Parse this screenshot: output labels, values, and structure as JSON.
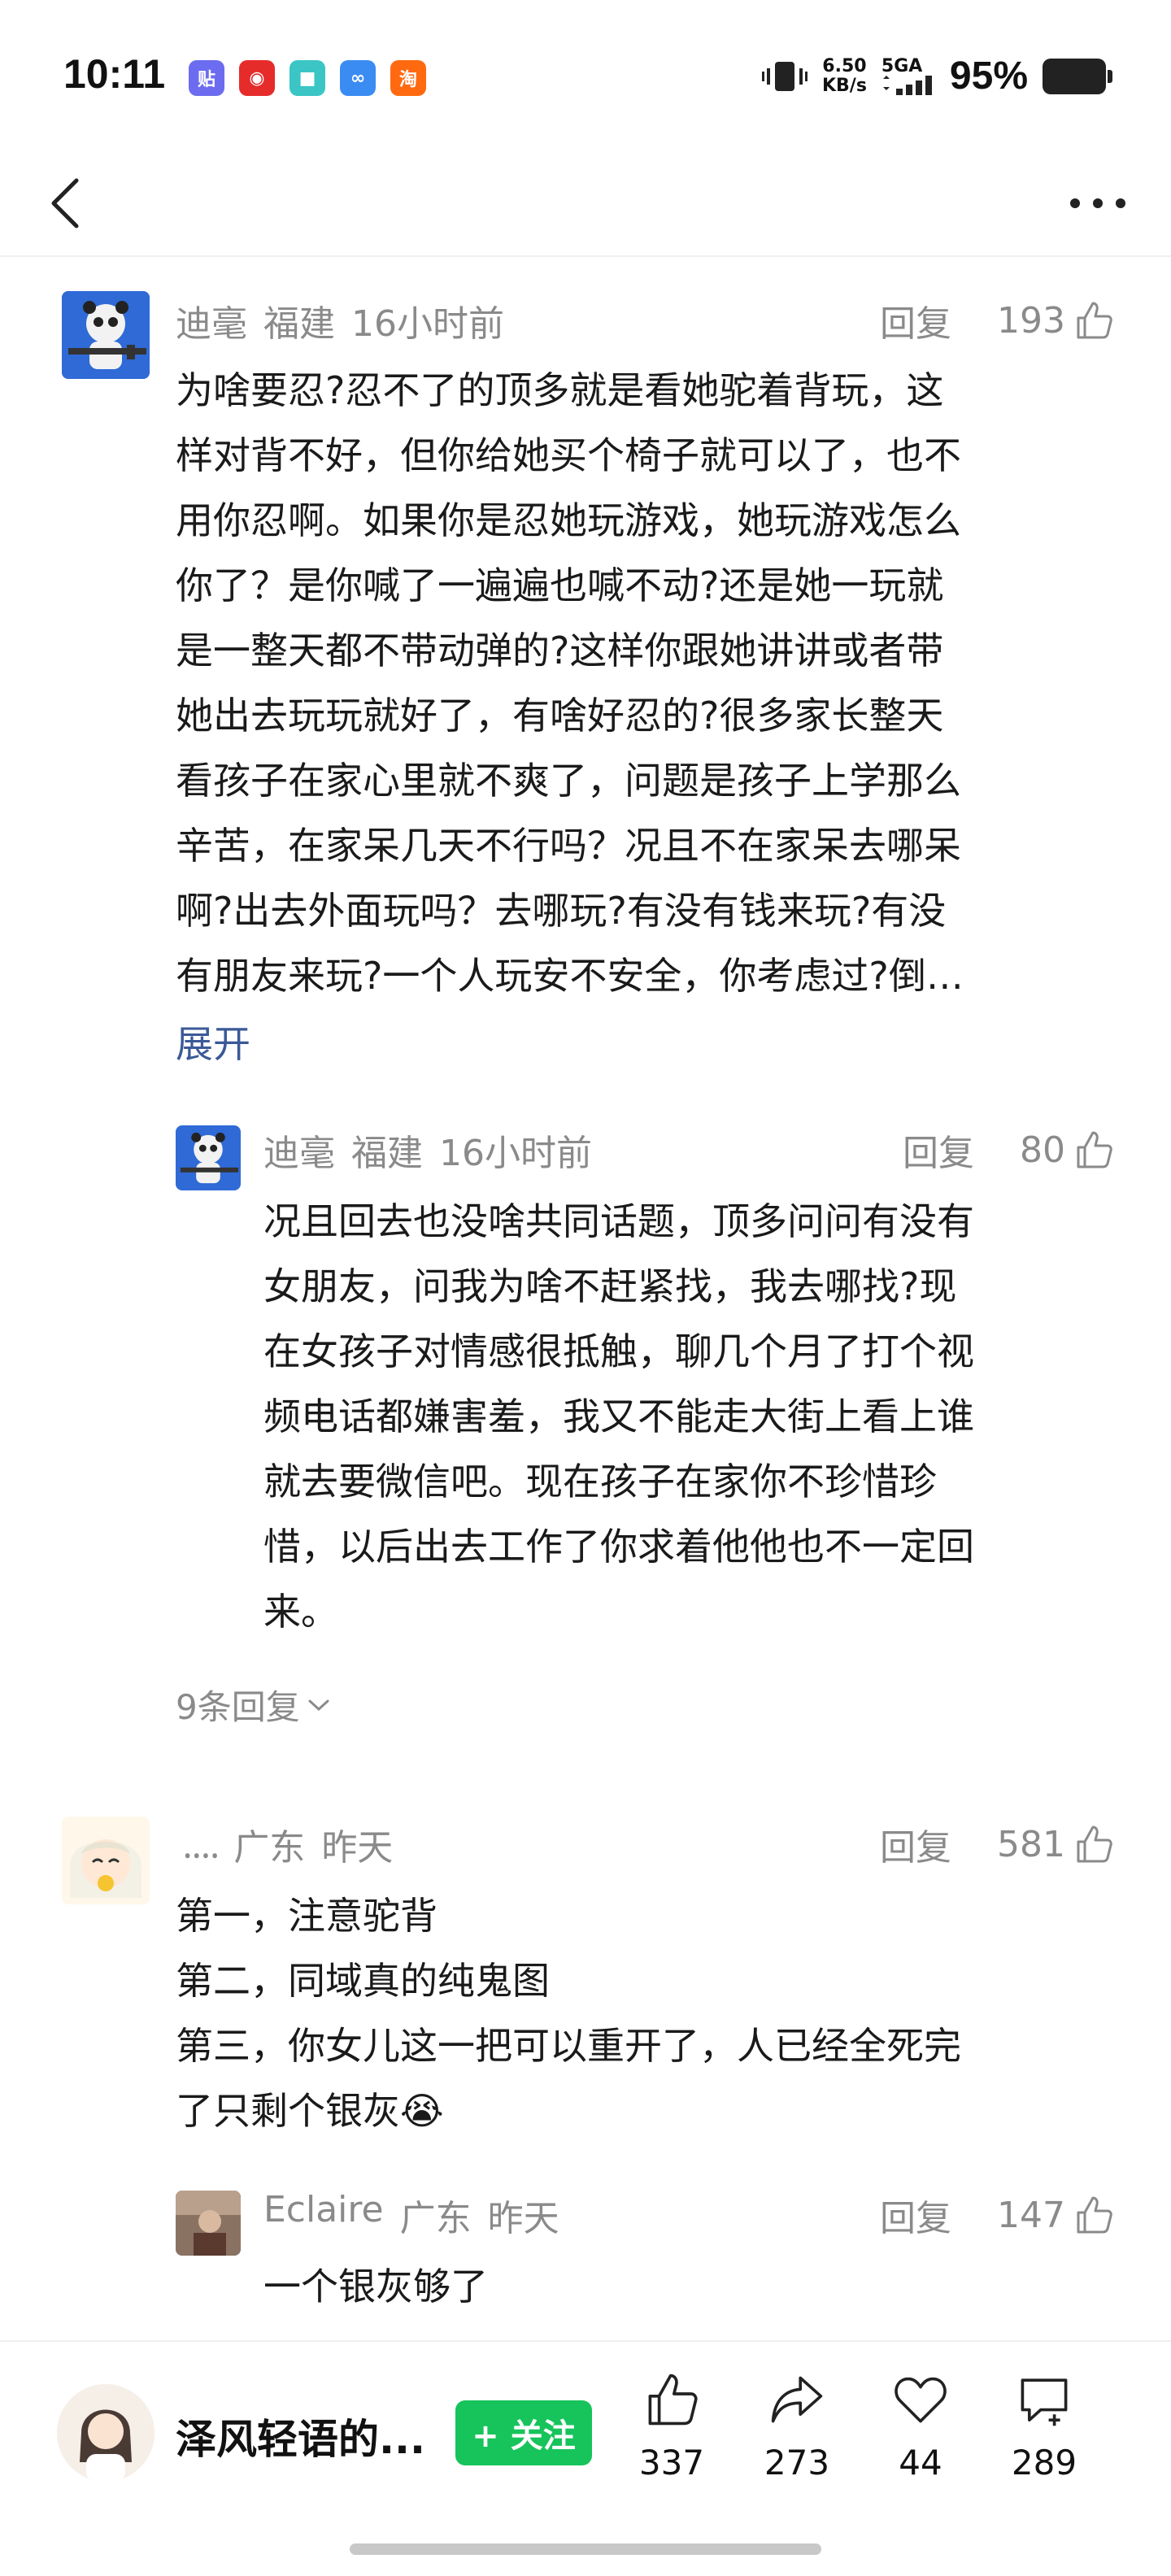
{
  "status_bar": {
    "time": "10:11",
    "app_icons": [
      {
        "name": "tieba-icon",
        "glyph": "贴",
        "color": "#6c6cf0"
      },
      {
        "name": "netease-music-icon",
        "glyph": "◉",
        "color": "#e62b2b"
      },
      {
        "name": "message-app-icon",
        "glyph": "■",
        "color": "#3bc5c5"
      },
      {
        "name": "baidu-netdisk-icon",
        "glyph": "∞",
        "color": "#3a8cf3"
      },
      {
        "name": "taobao-icon",
        "glyph": "淘",
        "color": "#ff6a10"
      }
    ],
    "net_speed_value": "6.50",
    "net_speed_unit": "KB/s",
    "network_type": "5GA",
    "battery_percent": "95%"
  },
  "comments": [
    {
      "username": "迪毫",
      "location": "福建",
      "time": "16小时前",
      "reply_label": "回复",
      "likes": "193",
      "lines": [
        "为啥要忍?忍不了的顶多就是看她驼着背玩，这",
        "样对背不好，但你给她买个椅子就可以了，也不",
        "用你忍啊。如果你是忍她玩游戏，她玩游戏怎么",
        "你了？是你喊了一遍遍也喊不动?还是她一玩就",
        "是一整天都不带动弹的?这样你跟她讲讲或者带",
        "她出去玩玩就好了，有啥好忍的?很多家长整天",
        "看孩子在家心里就不爽了，问题是孩子上学那么",
        "辛苦，在家呆几天不行吗？况且不在家呆去哪呆",
        "啊?出去外面玩吗？去哪玩?有没有钱来玩?有没",
        "有朋友来玩?一个人玩安不安全，你考虑过?倒…"
      ],
      "expand_label": "展开"
    },
    {
      "username": "迪毫",
      "location": "福建",
      "time": "16小时前",
      "reply_label": "回复",
      "likes": "80",
      "lines": [
        "况且回去也没啥共同话题，顶多问问有没有",
        "女朋友，问我为啥不赶紧找，我去哪找?现",
        "在女孩子对情感很抵触，聊几个月了打个视",
        "频电话都嫌害羞，我又不能走大街上看上谁",
        "就去要微信吧。现在孩子在家你不珍惜珍",
        "惜，以后出去工作了你求着他他也不一定回",
        "来。"
      ],
      "more_replies": "9条回复"
    },
    {
      "username": "᠁",
      "location": "广东",
      "time": "昨天",
      "reply_label": "回复",
      "likes": "581",
      "lines": [
        "第一，注意驼背",
        "第二，同域真的纯鬼图",
        "第三，你女儿这一把可以重开了，人已经全死完",
        "了只剩个银灰😭"
      ]
    },
    {
      "username": "Eclaire",
      "location": "广东",
      "time": "昨天",
      "reply_label": "回复",
      "likes": "147",
      "lines": [
        "一个银灰够了"
      ]
    }
  ],
  "bottom_bar": {
    "author_name": "泽风轻语的...",
    "follow_label": "+ 关注",
    "stats": [
      {
        "icon": "thumbs-up-icon",
        "count": "337"
      },
      {
        "icon": "share-icon",
        "count": "273"
      },
      {
        "icon": "heart-icon",
        "count": "44"
      },
      {
        "icon": "comment-icon",
        "count": "289"
      }
    ]
  },
  "colors": {
    "follow_green": "#16c45b",
    "link_blue": "#3b5998",
    "meta_gray": "#8a8a8a"
  }
}
